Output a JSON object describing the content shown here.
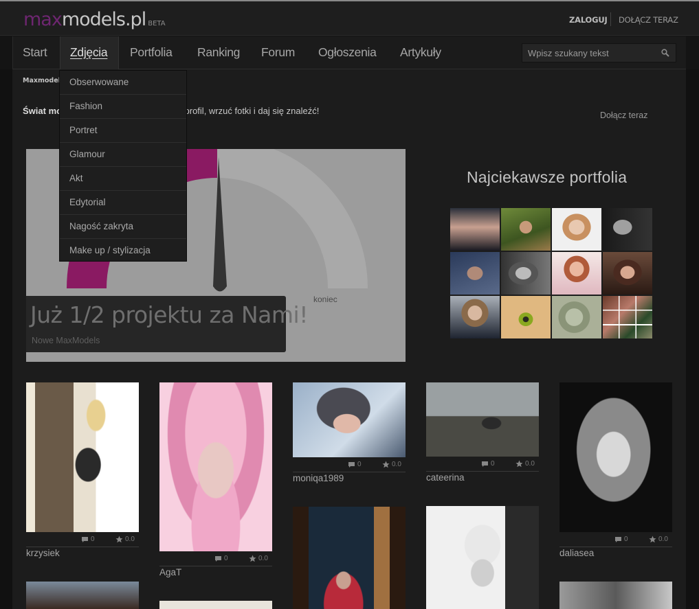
{
  "header": {
    "logo": {
      "max": "max",
      "models": "models.pl",
      "beta": "BETA"
    },
    "login": "ZALOGUJ",
    "join": "DOŁĄCZ TERAZ"
  },
  "nav": {
    "items": [
      {
        "label": "Start"
      },
      {
        "label": "Zdjęcia",
        "active": true
      },
      {
        "label": "Portfolia"
      },
      {
        "label": "Ranking"
      },
      {
        "label": "Forum"
      },
      {
        "label": "Ogłoszenia"
      },
      {
        "label": "Artykuły"
      }
    ],
    "search": {
      "placeholder": "Wpisz szukany tekst"
    }
  },
  "dropdown": {
    "items": [
      {
        "label": "Obserwowane"
      },
      {
        "label": "Fashion"
      },
      {
        "label": "Portret"
      },
      {
        "label": "Glamour"
      },
      {
        "label": "Akt"
      },
      {
        "label": "Edytorial"
      },
      {
        "label": "Nagość zakryta"
      },
      {
        "label": "Make up / stylizacja"
      }
    ]
  },
  "breadcrumb": "Maxmodels",
  "intro": {
    "bold": "Świat mo",
    "rest": "j profesjonalny profil, wrzuć fotki i daj się znaleźć!"
  },
  "join_right": "Dołącz teraz",
  "banner": {
    "title": "Już 1/2 projektu za Nami!",
    "subtitle": "Nowe MaxModels",
    "gauge_end_label": "koniec",
    "progress_fraction": 0.5
  },
  "portfolios": {
    "title": "Najciekawsze portfolia",
    "tiles": 12
  },
  "photos": [
    {
      "user": "krzysiek",
      "comments": "0",
      "rating": "0.0"
    },
    {
      "user": "AgaT",
      "comments": "0",
      "rating": "0.0"
    },
    {
      "user": "moniqa1989",
      "comments": "0",
      "rating": "0.0"
    },
    {
      "user": "cateerina",
      "comments": "0",
      "rating": "0.0"
    },
    {
      "user": "daliasea",
      "comments": "0",
      "rating": "0.0"
    }
  ],
  "colors": {
    "brand": "#6d2670",
    "gauge_fill": "#8a1a62",
    "background": "#141414"
  }
}
